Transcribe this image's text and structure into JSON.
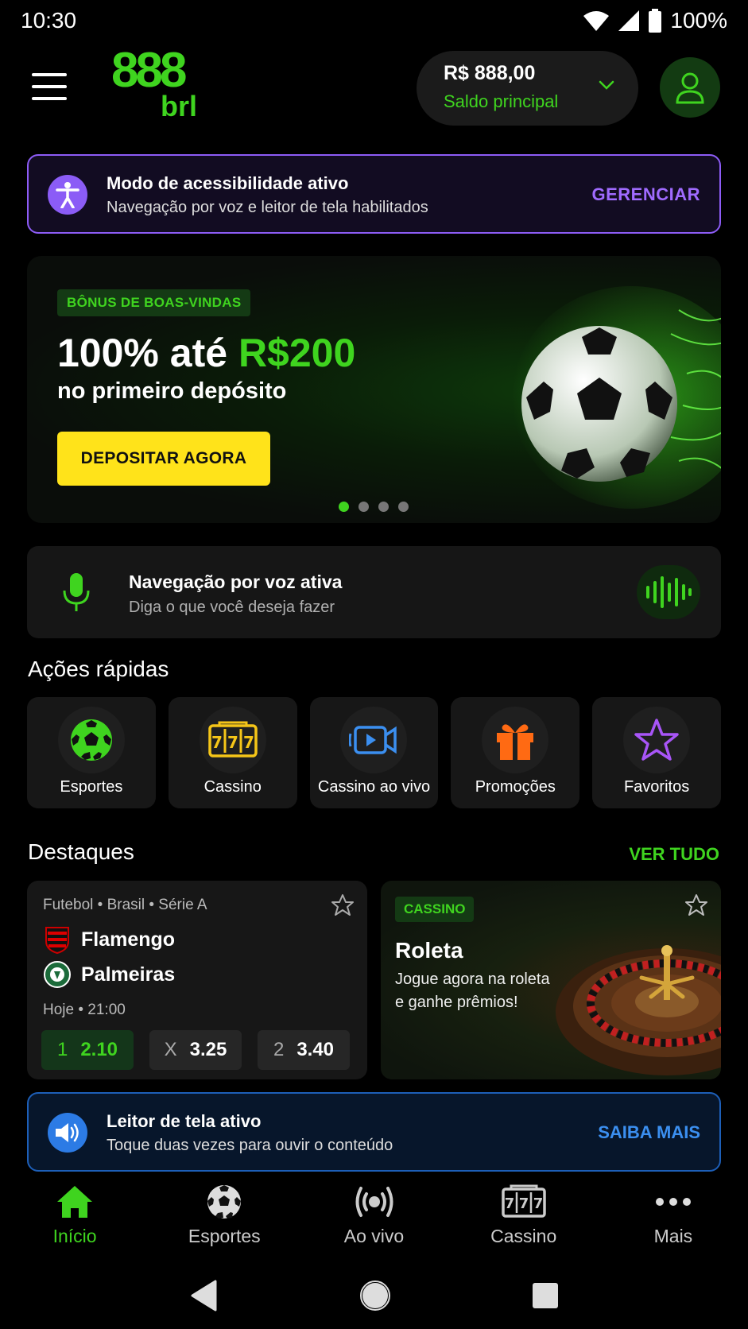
{
  "status_bar": {
    "time": "10:30",
    "battery": "100%"
  },
  "header": {
    "logo_top": "888",
    "logo_bottom": "brl",
    "balance_amount": "R$ 888,00",
    "balance_label": "Saldo principal"
  },
  "accessibility_banner": {
    "title": "Modo de acessibilidade ativo",
    "subtitle": "Navegação por voz e leitor de tela habilitados",
    "action": "GERENCIAR"
  },
  "hero": {
    "tag": "BÔNUS DE BOAS-VINDAS",
    "title_prefix": "100% até ",
    "title_highlight": "R$200",
    "subtitle": "no primeiro depósito",
    "cta": "DEPOSITAR AGORA",
    "carousel_total": 4,
    "carousel_active": 1
  },
  "voice_nav": {
    "title": "Navegação por voz ativa",
    "subtitle": "Diga o que você deseja fazer"
  },
  "quick_actions": {
    "title": "Ações rápidas",
    "items": [
      {
        "label": "Esportes",
        "icon": "soccer-ball-icon"
      },
      {
        "label": "Cassino",
        "icon": "slot-machine-icon"
      },
      {
        "label": "Cassino ao vivo",
        "icon": "live-video-icon"
      },
      {
        "label": "Promoções",
        "icon": "gift-icon"
      },
      {
        "label": "Favoritos",
        "icon": "star-icon"
      }
    ]
  },
  "highlights": {
    "title": "Destaques",
    "see_all": "VER TUDO",
    "match": {
      "league": "Futebol • Brasil • Série A",
      "home": "Flamengo",
      "away": "Palmeiras",
      "time": "Hoje • 21:00",
      "odds": [
        {
          "key": "1",
          "value": "2.10",
          "selected": true
        },
        {
          "key": "X",
          "value": "3.25",
          "selected": false
        },
        {
          "key": "2",
          "value": "3.40",
          "selected": false
        }
      ]
    },
    "casino": {
      "tag": "CASSINO",
      "title": "Roleta",
      "subtitle": "Jogue agora na roleta e ganhe prêmios!"
    }
  },
  "reader_banner": {
    "title": "Leitor de tela ativo",
    "subtitle": "Toque duas vezes para ouvir o conteúdo",
    "action": "SAIBA MAIS"
  },
  "bottom_nav": {
    "items": [
      {
        "label": "Início",
        "icon": "home-icon",
        "active": true
      },
      {
        "label": "Esportes",
        "icon": "soccer-ball-icon",
        "active": false
      },
      {
        "label": "Ao vivo",
        "icon": "live-broadcast-icon",
        "active": false
      },
      {
        "label": "Cassino",
        "icon": "slot-machine-icon",
        "active": false
      },
      {
        "label": "Mais",
        "icon": "more-dots-icon",
        "active": false
      }
    ]
  },
  "colors": {
    "brand_green": "#3fd41f",
    "accent_purple": "#8b5cf6",
    "accent_blue": "#2c7be5",
    "cta_yellow": "#ffe31a",
    "background": "#000000"
  }
}
